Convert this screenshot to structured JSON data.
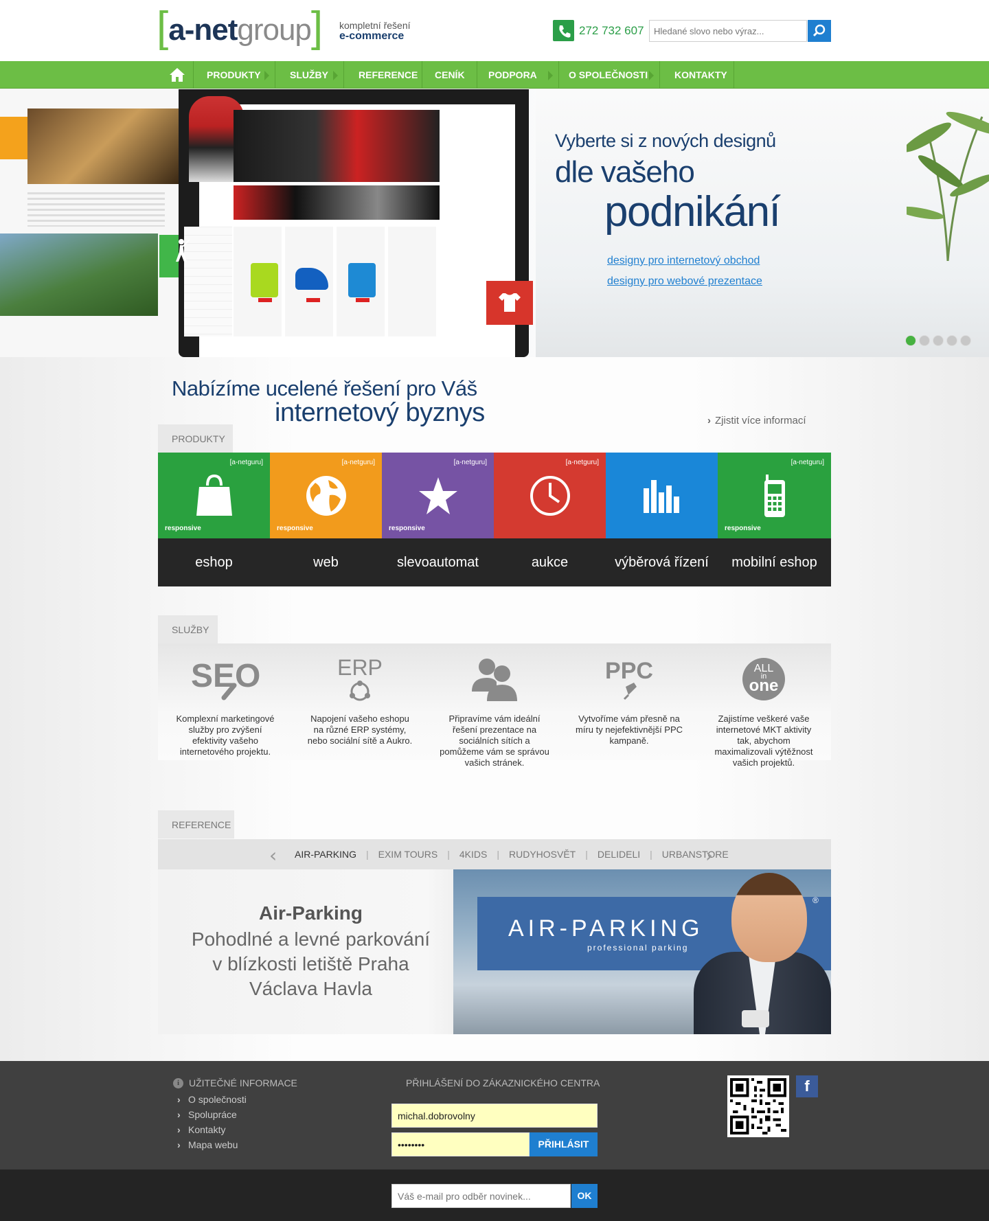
{
  "header": {
    "logo": {
      "bracket_open": "[",
      "part1": "a-net",
      "part2": "group",
      "bracket_close": "]"
    },
    "tagline_line1": "kompletní řešení",
    "tagline_line2": "e-commerce",
    "phone": "272 732 607",
    "search_placeholder": "Hledané slovo nebo výraz..."
  },
  "nav": {
    "items": [
      {
        "label": "PRODUKTY",
        "has_arrow": true
      },
      {
        "label": "SLUŽBY",
        "has_arrow": true
      },
      {
        "label": "REFERENCE",
        "has_arrow": false
      },
      {
        "label": "CENÍK",
        "has_arrow": false
      },
      {
        "label": "PODPORA",
        "has_arrow": true
      },
      {
        "label": "O SPOLEČNOSTI",
        "has_arrow": true
      },
      {
        "label": "KONTAKTY",
        "has_arrow": false
      }
    ]
  },
  "hero": {
    "line1": "Vyberte si z nových designů",
    "line2": "dle vašeho",
    "line3": "podnikání",
    "link1": "designy pro internetový obchod",
    "link2": "designy pro webové prezentace",
    "slides_total": 5,
    "active_slide": 1
  },
  "intro": {
    "line1": "Nabízíme ucelené řešení pro Váš",
    "line2": "internetový byznys",
    "more": "Zjistit více informací"
  },
  "products": {
    "tab": "PRODUKTY",
    "items": [
      {
        "label": "eshop",
        "badge": "[a-netguru]",
        "responsive": "responsive",
        "color": "#2aa13f",
        "icon": "shopping-bag-icon"
      },
      {
        "label": "web",
        "badge": "[a-netguru]",
        "responsive": "responsive",
        "color": "#f29b1c",
        "icon": "globe-icon"
      },
      {
        "label": "slevoautomat",
        "badge": "[a-netguru]",
        "responsive": "responsive",
        "color": "#7653a4",
        "icon": "star-icon"
      },
      {
        "label": "aukce",
        "badge": "[a-netguru]",
        "responsive": "",
        "color": "#d43a30",
        "icon": "clock-icon"
      },
      {
        "label": "výběrová řízení",
        "badge": "",
        "responsive": "",
        "color": "#1a87d8",
        "icon": "bar-chart-icon"
      },
      {
        "label": "mobilní eshop",
        "badge": "[a-netguru]",
        "responsive": "responsive",
        "color": "#2aa13f",
        "icon": "mobile-phone-icon"
      }
    ]
  },
  "services": {
    "tab": "SLUŽBY",
    "items": [
      {
        "icon_text": "SEO",
        "icon": "seo-icon",
        "text": "Komplexní marketingové služby pro zvýšení efektivity vašeho internetového projektu."
      },
      {
        "icon_text": "ERP",
        "icon": "erp-icon",
        "text": "Napojení vašeho eshopu na různé ERP systémy, nebo sociální sítě a Aukro."
      },
      {
        "icon_text": "",
        "icon": "users-icon",
        "text": "Připravíme vám ideální řešení prezentace na sociálních sítích a pomůžeme vám se správou vašich stránek."
      },
      {
        "icon_text": "PPC",
        "icon": "ppc-icon",
        "text": "Vytvoříme vám přesně na míru ty nejefektivnější PPC kampaně."
      },
      {
        "icon_text": "ALL",
        "icon_text2": "in",
        "icon_text3": "one",
        "icon": "all-in-one-icon",
        "text": "Zajistíme veškeré vaše internetové MKT aktivity tak, abychom maximalizovali výtěžnost vašich projektů."
      }
    ]
  },
  "references": {
    "tab": "REFERENCE",
    "items": [
      "AIR-PARKING",
      "EXIM TOURS",
      "4KIDS",
      "RUDYHOSVĚT",
      "DELIDELI",
      "URBANSTORE"
    ],
    "active": "AIR-PARKING",
    "title": "Air-Parking",
    "desc_lines": [
      "Pohodlné a levné parkování",
      "v blízkosti letiště Praha",
      "Václava Havla"
    ],
    "logo_text": "AIR-PARKING",
    "logo_sub": "professional parking",
    "logo_reg": "®"
  },
  "footer": {
    "info_title": "UŽITEČNÉ INFORMACE",
    "info_icon": "i",
    "links": [
      "O společnosti",
      "Spolupráce",
      "Kontakty",
      "Mapa webu"
    ],
    "login_title": "PŘIHLÁŠENÍ DO ZÁKAZNICKÉHO CENTRA",
    "username": "michal.dobrovolny",
    "password": "••••••••",
    "login_button": "PŘIHLÁSIT",
    "facebook": "f",
    "newsletter_placeholder": "Váš e-mail pro odběr novinek...",
    "newsletter_button": "OK"
  }
}
